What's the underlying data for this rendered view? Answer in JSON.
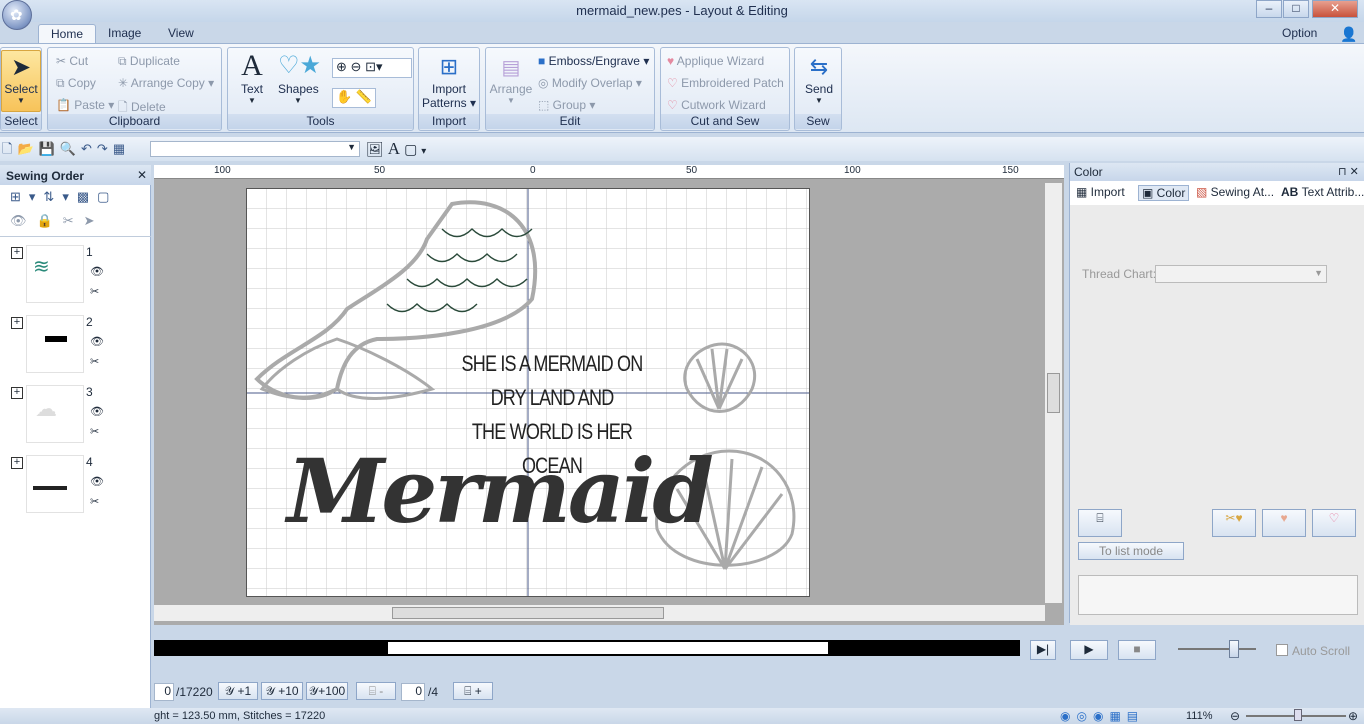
{
  "window": {
    "title": "mermaid_new.pes - Layout & Editing",
    "minimize": "–",
    "maximize": "□",
    "close": "✕"
  },
  "tabs": {
    "home": "Home",
    "image": "Image",
    "view": "View",
    "option": "Option"
  },
  "ribbon": {
    "select": {
      "label": "Select",
      "group": "Select"
    },
    "clipboard": {
      "cut": "Cut",
      "copy": "Copy",
      "paste": "Paste",
      "duplicate": "Duplicate",
      "arrange_copy": "Arrange Copy",
      "delete": "Delete",
      "group": "Clipboard"
    },
    "tools": {
      "text": "Text",
      "shapes": "Shapes",
      "group": "Tools"
    },
    "import": {
      "label1": "Import",
      "label2": "Patterns",
      "group": "Import"
    },
    "edit": {
      "arrange": "Arrange",
      "emboss": "Emboss/Engrave",
      "modify_overlap": "Modify Overlap",
      "group_btn": "Group",
      "group": "Edit"
    },
    "cutsew": {
      "applique": "Applique Wizard",
      "patch": "Embroidered Patch",
      "cutwork": "Cutwork Wizard",
      "group": "Cut and Sew"
    },
    "sew": {
      "send": "Send",
      "group": "Sew"
    }
  },
  "sewing_order": {
    "title": "Sewing Order",
    "items": [
      {
        "num": "1"
      },
      {
        "num": "2"
      },
      {
        "num": "3"
      },
      {
        "num": "4"
      }
    ]
  },
  "ruler": {
    "ticks": [
      "100",
      "50",
      "0",
      "50",
      "100",
      "150"
    ]
  },
  "design": {
    "line1": "SHE IS A MERMAID ON",
    "line2": "DRY LAND AND",
    "line3": "THE WORLD IS HER OCEAN",
    "script": "Mermaid"
  },
  "right_panel": {
    "title": "Color",
    "tabs": [
      "Import",
      "Color",
      "Sewing At...",
      "Text Attrib..."
    ],
    "thread_chart_label": "Thread Chart:",
    "list_mode": "To list mode"
  },
  "sim": {
    "auto_scroll": "Auto Scroll"
  },
  "bottom": {
    "stitch_count": "0",
    "stitch_total": "/17220",
    "plus1": "+1",
    "plus10": "+10",
    "plus100": "+100",
    "minus": "-",
    "color_count": "0",
    "color_total": "/4",
    "plus": "+"
  },
  "status": {
    "text": "ght = 123.50 mm, Stitches = 17220",
    "zoom": "111%"
  }
}
